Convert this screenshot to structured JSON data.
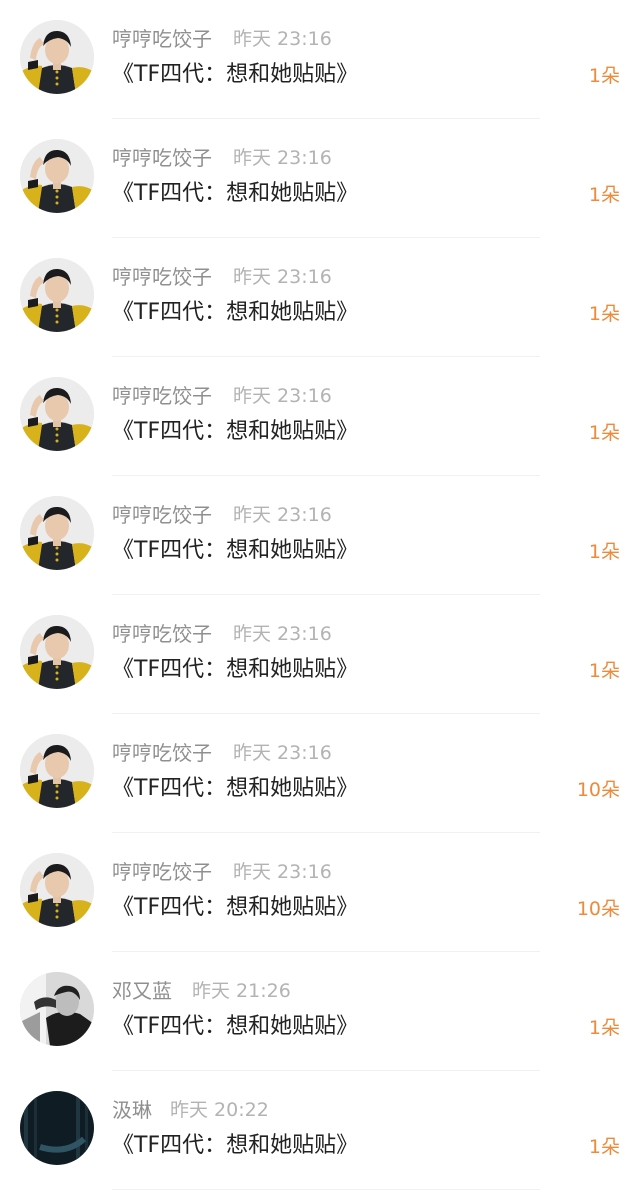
{
  "colors": {
    "name": "#8f8f8f",
    "time": "#b3b3b3",
    "title": "#222222",
    "amount": "#ee8a3a",
    "divider": "#f1f1f1"
  },
  "items": [
    {
      "avatar": "boy-photo-avatar",
      "name": "哼哼吃饺子",
      "time": "昨天 23:16",
      "title": "《TF四代：想和她贴贴》",
      "amount": "1朵"
    },
    {
      "avatar": "boy-photo-avatar",
      "name": "哼哼吃饺子",
      "time": "昨天 23:16",
      "title": "《TF四代：想和她贴贴》",
      "amount": "1朵"
    },
    {
      "avatar": "boy-photo-avatar",
      "name": "哼哼吃饺子",
      "time": "昨天 23:16",
      "title": "《TF四代：想和她贴贴》",
      "amount": "1朵"
    },
    {
      "avatar": "boy-photo-avatar",
      "name": "哼哼吃饺子",
      "time": "昨天 23:16",
      "title": "《TF四代：想和她贴贴》",
      "amount": "1朵"
    },
    {
      "avatar": "boy-photo-avatar",
      "name": "哼哼吃饺子",
      "time": "昨天 23:16",
      "title": "《TF四代：想和她贴贴》",
      "amount": "1朵"
    },
    {
      "avatar": "boy-photo-avatar",
      "name": "哼哼吃饺子",
      "time": "昨天 23:16",
      "title": "《TF四代：想和她贴贴》",
      "amount": "1朵"
    },
    {
      "avatar": "boy-photo-avatar",
      "name": "哼哼吃饺子",
      "time": "昨天 23:16",
      "title": "《TF四代：想和她贴贴》",
      "amount": "10朵"
    },
    {
      "avatar": "boy-photo-avatar",
      "name": "哼哼吃饺子",
      "time": "昨天 23:16",
      "title": "《TF四代：想和她贴贴》",
      "amount": "10朵"
    },
    {
      "avatar": "bw-portrait-avatar",
      "name": "邓又蓝",
      "time": "昨天 21:26",
      "title": "《TF四代：想和她贴贴》",
      "amount": "1朵"
    },
    {
      "avatar": "moon-forest-avatar",
      "name": "汲琳",
      "time": "昨天 20:22",
      "title": "《TF四代：想和她贴贴》",
      "amount": "1朵"
    }
  ]
}
